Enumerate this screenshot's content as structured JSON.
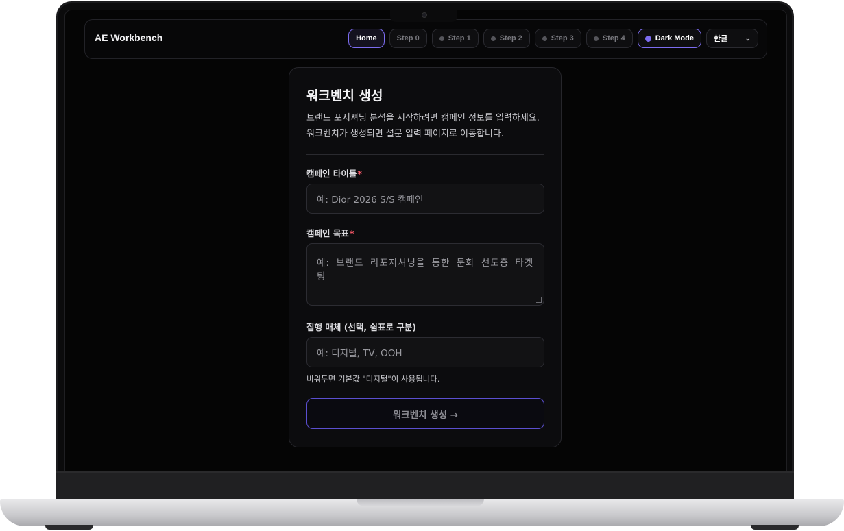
{
  "header": {
    "brand": "AE Workbench",
    "nav": [
      {
        "label": "Home",
        "active": true
      },
      {
        "label": "Step 0",
        "active": false
      },
      {
        "label": "Step 1",
        "active": false
      },
      {
        "label": "Step 2",
        "active": false
      },
      {
        "label": "Step 3",
        "active": false
      },
      {
        "label": "Step 4",
        "active": false
      }
    ],
    "dark_mode_label": "Dark Mode",
    "language": "한글"
  },
  "form": {
    "title": "워크벤치 생성",
    "description_line1": "브랜드 포지셔닝 분석을 시작하려면 캠페인 정보를 입력하세요.",
    "description_line2": "워크벤치가 생성되면 설문 입력 페이지로 이동합니다.",
    "campaign_title_label": "캠페인 타이틀",
    "campaign_title_placeholder": "예: Dior 2026 S/S 캠페인",
    "campaign_goal_label": "캠페인 목표",
    "campaign_goal_placeholder": "예: 브랜드 리포지셔닝을 통한 문화 선도층 타겟팅",
    "media_label": "집행 매체 (선택, 쉼표로 구분)",
    "media_placeholder": "예: 디지털, TV, OOH",
    "media_hint": "비워두면 기본값 \"디지털\"이 사용됩니다.",
    "required_mark": "*",
    "submit_label": "워크벤치 생성 →"
  },
  "colors": {
    "accent": "#7c6cf0",
    "required": "#ff5a6a",
    "background": "#050505"
  }
}
